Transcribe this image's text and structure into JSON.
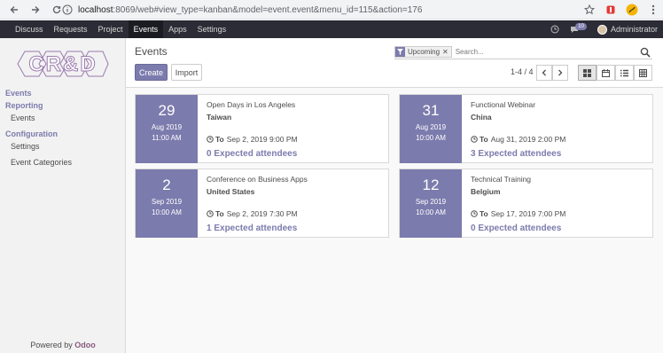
{
  "browser": {
    "url_host": "localhost",
    "url_rest": ":8069/web#view_type=kanban&model=event.event&menu_id=115&action=176"
  },
  "topnav": {
    "menu": [
      "Discuss",
      "Requests",
      "Project",
      "Events",
      "Apps",
      "Settings"
    ],
    "active": "Events",
    "message_count": "10",
    "user": "Administrator"
  },
  "sidebar": {
    "sections": [
      {
        "label": "Events"
      },
      {
        "label": "Reporting"
      },
      {
        "label": "Events",
        "sub": true
      },
      {
        "label": "Configuration"
      },
      {
        "label": "Settings",
        "sub": true
      },
      {
        "label": "Event Categories",
        "sub": true
      }
    ],
    "powered_prefix": "Powered by ",
    "powered_brand": "Odoo",
    "logo_text": "CR&D"
  },
  "control": {
    "title": "Events",
    "create_label": "Create",
    "import_label": "Import",
    "facet_label": "Upcoming",
    "search_placeholder": "Search...",
    "pager": "1-4 / 4"
  },
  "events": [
    {
      "day": "29",
      "month": "Aug 2019",
      "time": "11:00 AM",
      "title": "Open Days in Los Angeles",
      "country": "Taiwan",
      "to_label": "To",
      "to_date": "Sep 2, 2019 9:00 PM",
      "attendees": "0 Expected attendees"
    },
    {
      "day": "31",
      "month": "Aug 2019",
      "time": "10:00 AM",
      "title": "Functional Webinar",
      "country": "China",
      "to_label": "To",
      "to_date": "Aug 31, 2019 2:00 PM",
      "attendees": "3 Expected attendees"
    },
    {
      "day": "2",
      "month": "Sep 2019",
      "time": "10:00 AM",
      "title": "Conference on Business Apps",
      "country": "United States",
      "to_label": "To",
      "to_date": "Sep 2, 2019 7:30 PM",
      "attendees": "1 Expected attendees"
    },
    {
      "day": "12",
      "month": "Sep 2019",
      "time": "10:00 AM",
      "title": "Technical Training",
      "country": "Belgium",
      "to_label": "To",
      "to_date": "Sep 17, 2019 7:00 PM",
      "attendees": "0 Expected attendees"
    }
  ],
  "colors": {
    "accent": "#7c7bad",
    "topbar": "#2c2c36",
    "brand": "#875a7b"
  }
}
